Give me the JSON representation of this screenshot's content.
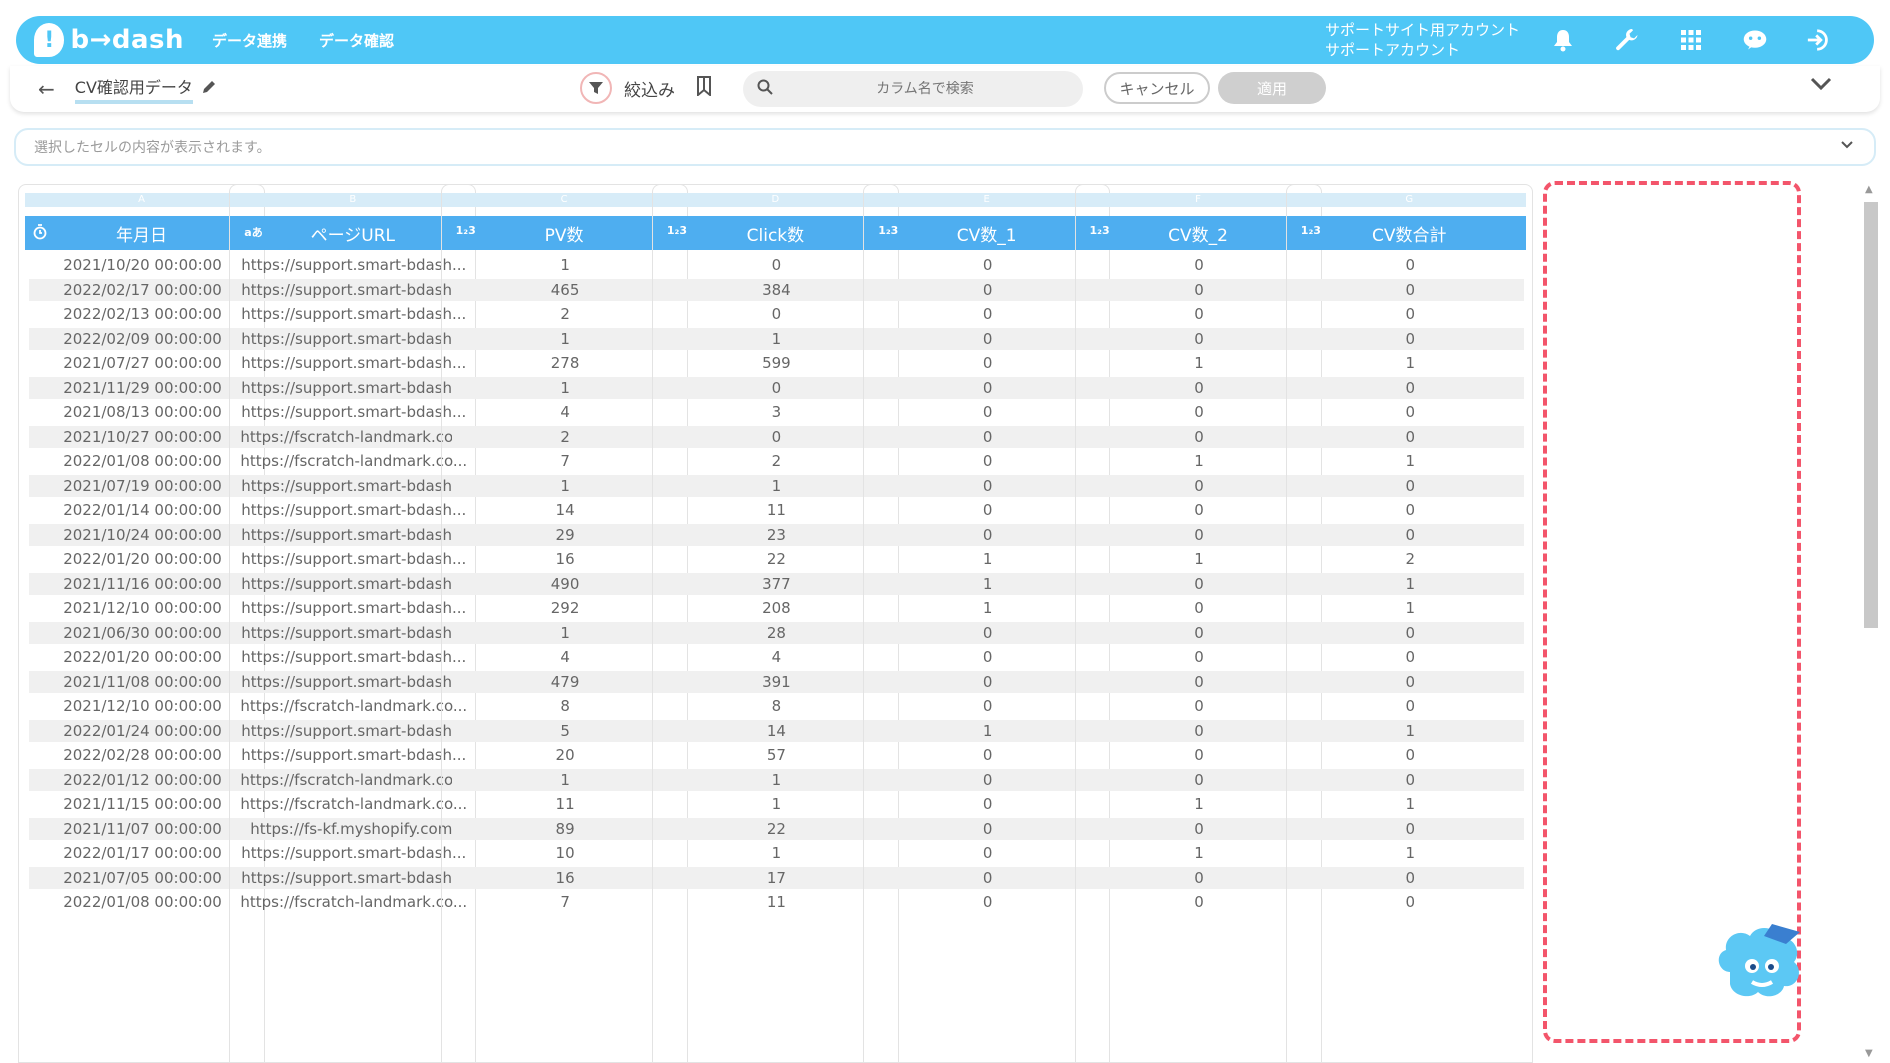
{
  "header": {
    "logo_text": "b→dash",
    "nav": [
      "データ連携",
      "データ確認"
    ],
    "account_line1": "サポートサイト用アカウント",
    "account_line2": "サポートアカウント",
    "icons": [
      "bell-icon",
      "wrench-icon",
      "grid-icon",
      "chat-bot-icon",
      "logout-icon"
    ]
  },
  "toolbar": {
    "dataset_name": "CV確認用データ",
    "filter_label": "絞込み",
    "search_placeholder": "カラム名で検索",
    "cancel_label": "キャンセル",
    "apply_label": "適用"
  },
  "cell_preview": {
    "placeholder": "選択したセルの内容が表示されます。"
  },
  "accent_colors": {
    "header_bg": "#4fc7f6",
    "column_header_bg": "#4eaef0",
    "highlight_border": "#f3556b"
  },
  "table": {
    "columns": [
      {
        "letter": "A",
        "type_icon": "clock-icon",
        "type_text": "",
        "name": "年月日"
      },
      {
        "letter": "B",
        "type_icon": "text-type-icon",
        "type_text": "aあ",
        "name": "ページURL"
      },
      {
        "letter": "C",
        "type_icon": "number-type-icon",
        "type_text": "1₂3",
        "name": "PV数"
      },
      {
        "letter": "D",
        "type_icon": "number-type-icon",
        "type_text": "1₂3",
        "name": "Click数"
      },
      {
        "letter": "E",
        "type_icon": "number-type-icon",
        "type_text": "1₂3",
        "name": "CV数_1"
      },
      {
        "letter": "F",
        "type_icon": "number-type-icon",
        "type_text": "1₂3",
        "name": "CV数_2"
      },
      {
        "letter": "G",
        "type_icon": "number-type-icon",
        "type_text": "1₂3",
        "name": "CV数合計"
      }
    ],
    "rows": [
      [
        "2021/10/20 00:00:00",
        "https://support.smart-bdash...",
        "1",
        "0",
        "0",
        "0",
        "0"
      ],
      [
        "2022/02/17 00:00:00",
        "https://support.smart-bdash...",
        "465",
        "384",
        "0",
        "0",
        "0"
      ],
      [
        "2022/02/13 00:00:00",
        "https://support.smart-bdash...",
        "2",
        "0",
        "0",
        "0",
        "0"
      ],
      [
        "2022/02/09 00:00:00",
        "https://support.smart-bdash...",
        "1",
        "1",
        "0",
        "0",
        "0"
      ],
      [
        "2021/07/27 00:00:00",
        "https://support.smart-bdash...",
        "278",
        "599",
        "0",
        "1",
        "1"
      ],
      [
        "2021/11/29 00:00:00",
        "https://support.smart-bdash...",
        "1",
        "0",
        "0",
        "0",
        "0"
      ],
      [
        "2021/08/13 00:00:00",
        "https://support.smart-bdash...",
        "4",
        "3",
        "0",
        "0",
        "0"
      ],
      [
        "2021/10/27 00:00:00",
        "https://fscratch-landmark.co...",
        "2",
        "0",
        "0",
        "0",
        "0"
      ],
      [
        "2022/01/08 00:00:00",
        "https://fscratch-landmark.co...",
        "7",
        "2",
        "0",
        "1",
        "1"
      ],
      [
        "2021/07/19 00:00:00",
        "https://support.smart-bdash...",
        "1",
        "1",
        "0",
        "0",
        "0"
      ],
      [
        "2022/01/14 00:00:00",
        "https://support.smart-bdash...",
        "14",
        "11",
        "0",
        "0",
        "0"
      ],
      [
        "2021/10/24 00:00:00",
        "https://support.smart-bdash...",
        "29",
        "23",
        "0",
        "0",
        "0"
      ],
      [
        "2022/01/20 00:00:00",
        "https://support.smart-bdash...",
        "16",
        "22",
        "1",
        "1",
        "2"
      ],
      [
        "2021/11/16 00:00:00",
        "https://support.smart-bdash...",
        "490",
        "377",
        "1",
        "0",
        "1"
      ],
      [
        "2021/12/10 00:00:00",
        "https://support.smart-bdash...",
        "292",
        "208",
        "1",
        "0",
        "1"
      ],
      [
        "2021/06/30 00:00:00",
        "https://support.smart-bdash...",
        "1",
        "28",
        "0",
        "0",
        "0"
      ],
      [
        "2022/01/20 00:00:00",
        "https://support.smart-bdash...",
        "4",
        "4",
        "0",
        "0",
        "0"
      ],
      [
        "2021/11/08 00:00:00",
        "https://support.smart-bdash...",
        "479",
        "391",
        "0",
        "0",
        "0"
      ],
      [
        "2021/12/10 00:00:00",
        "https://fscratch-landmark.co...",
        "8",
        "8",
        "0",
        "0",
        "0"
      ],
      [
        "2022/01/24 00:00:00",
        "https://support.smart-bdash...",
        "5",
        "14",
        "1",
        "0",
        "1"
      ],
      [
        "2022/02/28 00:00:00",
        "https://support.smart-bdash...",
        "20",
        "57",
        "0",
        "0",
        "0"
      ],
      [
        "2022/01/12 00:00:00",
        "https://fscratch-landmark.co...",
        "1",
        "1",
        "0",
        "0",
        "0"
      ],
      [
        "2021/11/15 00:00:00",
        "https://fscratch-landmark.co...",
        "11",
        "1",
        "0",
        "1",
        "1"
      ],
      [
        "2021/11/07 00:00:00",
        "https://fs-kf.myshopify.com/",
        "89",
        "22",
        "0",
        "0",
        "0"
      ],
      [
        "2022/01/17 00:00:00",
        "https://support.smart-bdash...",
        "10",
        "1",
        "0",
        "1",
        "1"
      ],
      [
        "2021/07/05 00:00:00",
        "https://support.smart-bdash...",
        "16",
        "17",
        "0",
        "0",
        "0"
      ],
      [
        "2022/01/08 00:00:00",
        "https://fscratch-landmark.co...",
        "7",
        "11",
        "0",
        "0",
        "0"
      ]
    ]
  }
}
